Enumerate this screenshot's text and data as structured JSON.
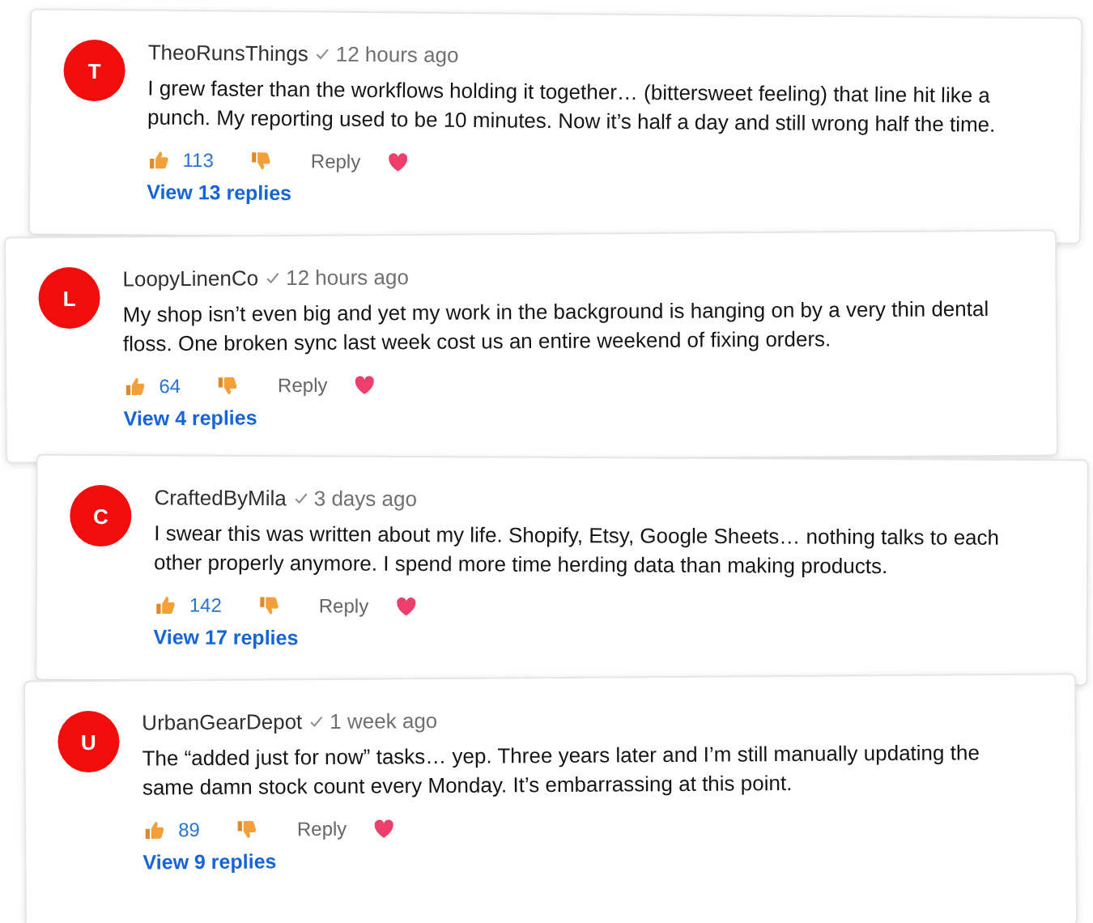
{
  "comments": [
    {
      "avatar": "T",
      "author": "TheoRunsThings",
      "time": "12 hours ago",
      "text": "I grew faster than the workflows holding it together… (bittersweet feeling) that line hit like a punch. My reporting used to be 10 minutes. Now it’s half a day and still wrong half the time.",
      "likes": "113",
      "reply": "Reply",
      "replies": "View 13 replies"
    },
    {
      "avatar": "L",
      "author": "LoopyLinenCo",
      "time": "12 hours ago",
      "text": "My shop isn’t even big and yet my work in the background is hanging on by a very thin dental floss. One broken sync last week cost us an entire weekend of fixing orders.",
      "likes": "64",
      "reply": "Reply",
      "replies": "View 4 replies"
    },
    {
      "avatar": "C",
      "author": "CraftedByMila",
      "time": "3 days ago",
      "text": "I swear this was written about my life. Shopify, Etsy, Google Sheets… nothing talks to each other properly anymore. I spend more time herding data than making products.",
      "likes": "142",
      "reply": "Reply",
      "replies": "View 17 replies"
    },
    {
      "avatar": "U",
      "author": "UrbanGearDepot",
      "time": "1 week ago",
      "text": "The “added just for now” tasks… yep. Three years later and I’m still manually updating the same damn stock count every Monday. It’s embarrassing at this point.",
      "likes": "89",
      "reply": "Reply",
      "replies": "View 9 replies"
    }
  ]
}
